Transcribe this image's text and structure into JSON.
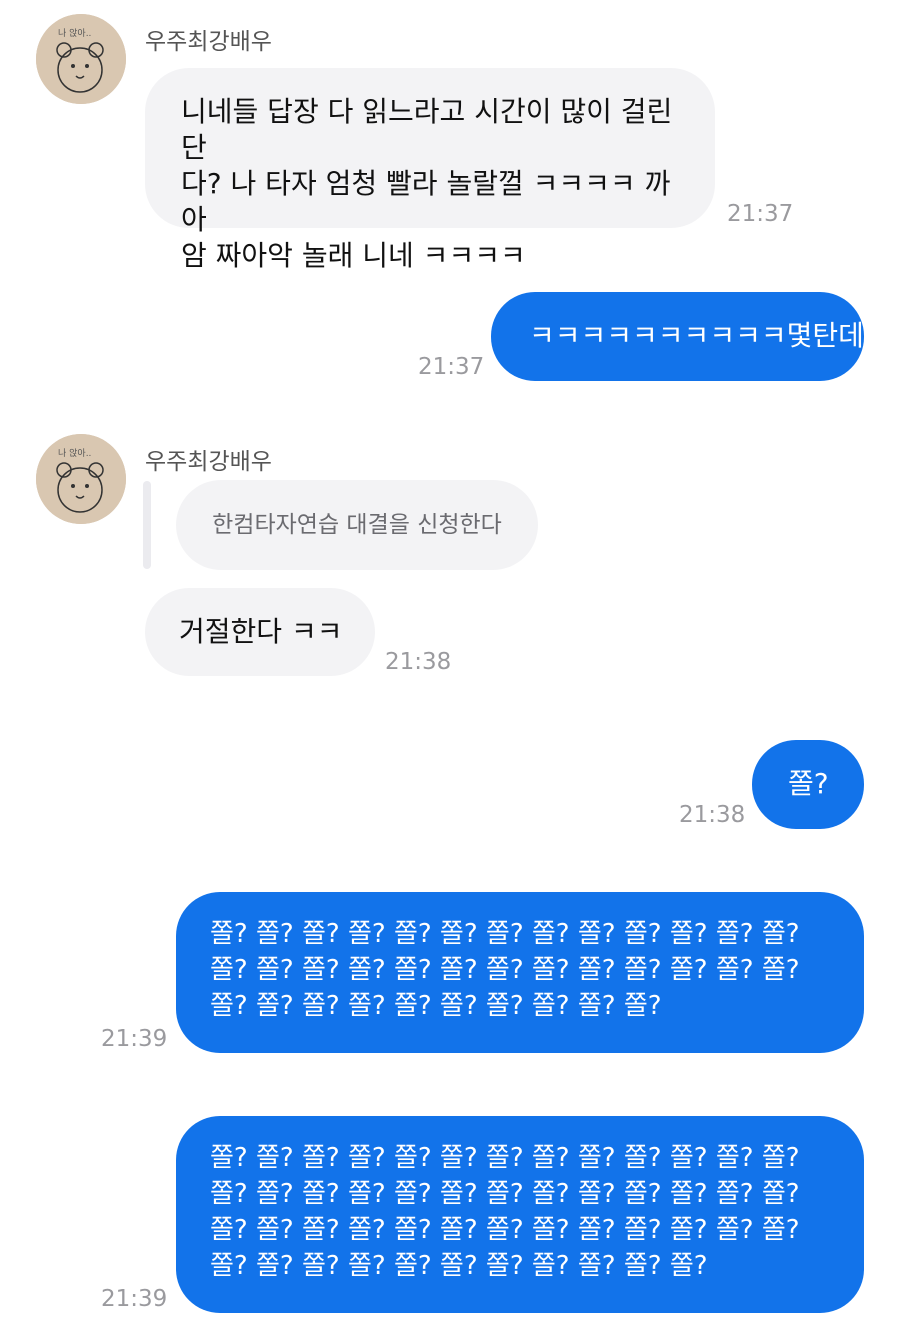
{
  "conversation": {
    "messages": [
      {
        "sender": "우주최강배우",
        "text": "니네들 답장 다 읽느라고 시간이 많이 걸린단\n다? 나 타자 엄청 빨라 놀랄껄 ㅋㅋㅋㅋ 까아\n암 짜아악 놀래 니네 ㅋㅋㅋㅋ",
        "time": "21:37"
      },
      {
        "text": "ㅋㅋㅋㅋㅋㅋㅋㅋㅋㅋ몇탄데",
        "time": "21:37"
      },
      {
        "sender": "우주최강배우",
        "reply_to": "한컴타자연습 대결을 신청한다"
      },
      {
        "text": "거절한다 ㅋㅋ",
        "time": "21:38"
      },
      {
        "text": "쫄?",
        "time": "21:38"
      },
      {
        "text": "쫄? 쫄? 쫄? 쫄? 쫄? 쫄? 쫄? 쫄? 쫄? 쫄? 쫄? 쫄? 쫄?\n쫄? 쫄? 쫄? 쫄? 쫄? 쫄? 쫄? 쫄? 쫄? 쫄? 쫄? 쫄? 쫄?\n쫄? 쫄? 쫄? 쫄? 쫄? 쫄? 쫄? 쫄? 쫄? 쫄?",
        "time": "21:39"
      },
      {
        "text": "쫄? 쫄? 쫄? 쫄? 쫄? 쫄? 쫄? 쫄? 쫄? 쫄? 쫄? 쫄? 쫄?\n쫄? 쫄? 쫄? 쫄? 쫄? 쫄? 쫄? 쫄? 쫄? 쫄? 쫄? 쫄? 쫄?\n쫄? 쫄? 쫄? 쫄? 쫄? 쫄? 쫄? 쫄? 쫄? 쫄? 쫄? 쫄? 쫄?\n쫄? 쫄? 쫄? 쫄? 쫄? 쫄? 쫄? 쫄? 쫄? 쫄? 쫄?",
        "time": "21:39"
      }
    ]
  },
  "avatar": {
    "icon": "bear-sketch-icon",
    "caption": "나 앉아.."
  },
  "colors": {
    "outgoing_bubble": "#1273ea",
    "incoming_bubble": "#f3f3f5",
    "timestamp": "#9a9a9e"
  }
}
